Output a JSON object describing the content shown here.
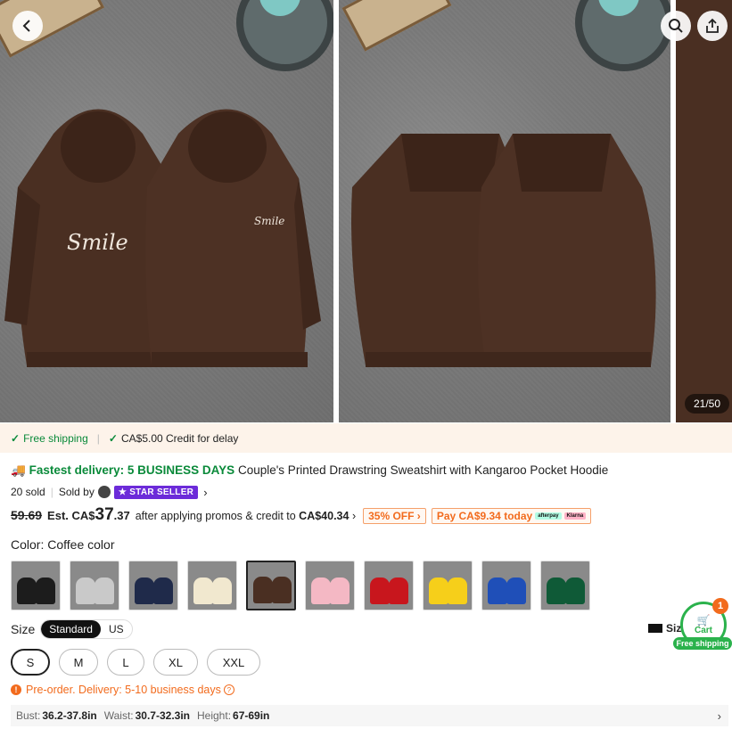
{
  "gallery": {
    "counter": "21/50",
    "back_icon": "back-arrow-icon",
    "search_icon": "search-icon",
    "share_icon": "share-icon"
  },
  "shipping_bar": {
    "free_shipping": "Free shipping",
    "credit": "CA$5.00 Credit for delay"
  },
  "product": {
    "fastest_delivery": "Fastest delivery: 5 BUSINESS DAYS",
    "title": "Couple's Printed Drawstring Sweatshirt with Kangaroo Pocket Hoodie",
    "sold": "20 sold",
    "sold_by": "Sold by",
    "seller_badge": "STAR SELLER"
  },
  "price": {
    "original": "59.69",
    "est_prefix": "Est. CA$",
    "est_whole": "37",
    "est_cents": ".37",
    "after_text": "after applying promos & credit to",
    "after_amount": "CA$40.34",
    "discount_tag": "35% OFF",
    "pay_today": "Pay CA$9.34 today",
    "pay_logo_1": "afterpay",
    "pay_logo_2": "Klarna"
  },
  "color": {
    "label": "Color:",
    "selected": "Coffee color",
    "swatches": [
      {
        "name": "black",
        "hex": "#1c1c1c"
      },
      {
        "name": "gray",
        "hex": "#c9c9c9"
      },
      {
        "name": "navy",
        "hex": "#1f2a4a"
      },
      {
        "name": "apricot",
        "hex": "#f1e8cf"
      },
      {
        "name": "coffee",
        "hex": "#4a2f22",
        "selected": true
      },
      {
        "name": "pink",
        "hex": "#f4b8c4"
      },
      {
        "name": "red",
        "hex": "#c8161d"
      },
      {
        "name": "yellow",
        "hex": "#f6cf1a"
      },
      {
        "name": "blue",
        "hex": "#1f4fb8"
      },
      {
        "name": "green",
        "hex": "#0f5a37"
      }
    ]
  },
  "size": {
    "label": "Size",
    "toggle_standard": "Standard",
    "toggle_us": "US",
    "guide": "Siz",
    "options": [
      "S",
      "M",
      "L",
      "XL",
      "XXL"
    ],
    "selected": "S"
  },
  "preorder": "Pre-order. Delivery: 5-10 business days",
  "measurements": {
    "bust_label": "Bust:",
    "bust": "36.2-37.8in",
    "waist_label": "Waist:",
    "waist": "30.7-32.3in",
    "height_label": "Height:",
    "height": "67-69in"
  },
  "cart": {
    "count": "1",
    "label": "Cart",
    "free_shipping": "Free shipping"
  },
  "colors": {
    "green": "#0a8a3a",
    "orange": "#f26b1d",
    "purple": "#6c2bd9",
    "hoodie_brown": "#4a2f22"
  }
}
